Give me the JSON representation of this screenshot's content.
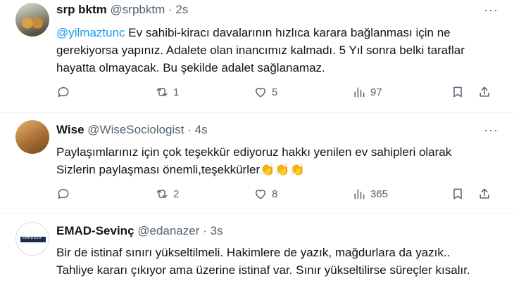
{
  "tweets": [
    {
      "name": "srp bktm",
      "handle": "@srpbktm",
      "sep": "·",
      "time": "2s",
      "mention": "@yilmaztunc",
      "text": " Ev sahibi-kiracı davalarının hızlıca karara bağlanması için ne gerekiyorsa yapınız. Adalete olan inancımız kalmadı. 5 Yıl sonra belki taraflar hayatta olmayacak. Bu şekilde adalet sağlanamaz.",
      "retweets": "1",
      "likes": "5",
      "views": "97"
    },
    {
      "name": "Wise",
      "handle": "@WiseSociologist",
      "sep": "·",
      "time": "4s",
      "text": "Paylaşımlarınız için çok teşekkür ediyoruz hakkı yenilen ev sahipleri olarak Sizlerin paylaşması önemli,teşekkürler",
      "emoji": "👏👏👏",
      "retweets": "2",
      "likes": "8",
      "views": "365"
    },
    {
      "name": "EMAD-Sevinç",
      "handle": "@edanazer",
      "sep": "·",
      "time": "3s",
      "text": "Bir de istinaf sınırı yükseltilmeli. Hakimlere de yazık, mağdurlara da yazık.. Tahliye kararı çıkıyor ama üzerine istinaf var. Sınır yükseltilirse süreçler kısalır."
    }
  ],
  "more_label": "···",
  "avatar3_logo": "EMADDER",
  "colors": {
    "accent": "#1d9bf0",
    "muted": "#536471",
    "text": "#0f1419"
  }
}
